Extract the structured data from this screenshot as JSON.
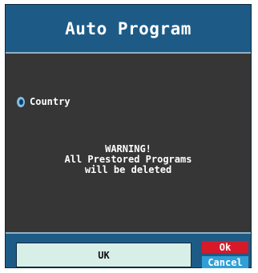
{
  "dialog": {
    "title": "Auto Program"
  },
  "options": [
    {
      "label": "Country",
      "selected": true
    }
  ],
  "warning": {
    "lines": [
      "WARNING!",
      "All Prestored Programs",
      "will be deleted"
    ]
  },
  "footer": {
    "country_value": "UK",
    "ok_label": "Ok",
    "cancel_label": "Cancel"
  },
  "colors": {
    "title_bar": "#1d5b86",
    "body": "#363636",
    "ok_button": "#d61a2a",
    "cancel_button": "#2f9fd6",
    "country_box": "#d8efe8"
  }
}
